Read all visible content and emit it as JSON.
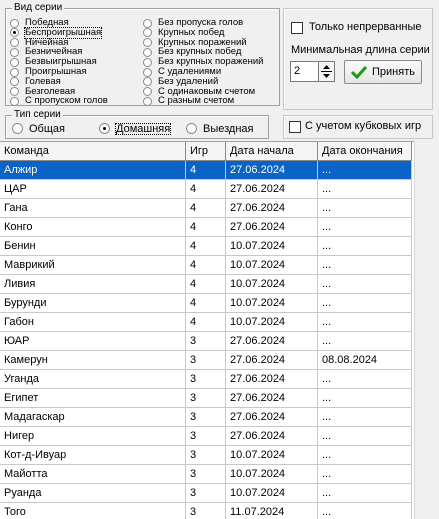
{
  "series_kind": {
    "legend": "Вид серии",
    "col1": [
      "Победная",
      "Беспроигрышная",
      "Ничейная",
      "Безничейная",
      "Безвыигрышная",
      "Проигрышная",
      "Голевая",
      "Безголевая",
      "С пропуском голов"
    ],
    "col2": [
      "Без пропуска голов",
      "Крупных побед",
      "Крупных поражений",
      "Без крупных побед",
      "Без крупных поражений",
      "С удалениями",
      "Без удалений",
      "С одинаковым счетом",
      "С разным счетом"
    ],
    "selected": "Беспроигрышная"
  },
  "options": {
    "only_continuous_label": "Только непрерванные",
    "only_continuous_checked": false,
    "min_length_label": "Минимальная длина серии",
    "min_length_value": "2",
    "apply_label": "Принять",
    "cup_games_label": "С учетом кубковых игр",
    "cup_games_checked": false
  },
  "series_type": {
    "legend": "Тип серии",
    "options": [
      "Общая",
      "Домашняя",
      "Выездная"
    ],
    "selected": "Домашняя"
  },
  "table": {
    "columns": [
      "Команда",
      "Игр",
      "Дата начала",
      "Дата окончания"
    ],
    "rows": [
      [
        "Алжир",
        "4",
        "27.06.2024",
        "..."
      ],
      [
        "ЦАР",
        "4",
        "27.06.2024",
        "..."
      ],
      [
        "Гана",
        "4",
        "27.06.2024",
        "..."
      ],
      [
        "Конго",
        "4",
        "27.06.2024",
        "..."
      ],
      [
        "Бенин",
        "4",
        "10.07.2024",
        "..."
      ],
      [
        "Маврикий",
        "4",
        "10.07.2024",
        "..."
      ],
      [
        "Ливия",
        "4",
        "10.07.2024",
        "..."
      ],
      [
        "Бурунди",
        "4",
        "10.07.2024",
        "..."
      ],
      [
        "Габон",
        "4",
        "10.07.2024",
        "..."
      ],
      [
        "ЮАР",
        "3",
        "27.06.2024",
        "..."
      ],
      [
        "Камерун",
        "3",
        "27.06.2024",
        "08.08.2024"
      ],
      [
        "Уганда",
        "3",
        "27.06.2024",
        "..."
      ],
      [
        "Египет",
        "3",
        "27.06.2024",
        "..."
      ],
      [
        "Мадагаскар",
        "3",
        "27.06.2024",
        "..."
      ],
      [
        "Нигер",
        "3",
        "27.06.2024",
        "..."
      ],
      [
        "Кот-д-Ивуар",
        "3",
        "10.07.2024",
        "..."
      ],
      [
        "Майотта",
        "3",
        "10.07.2024",
        "..."
      ],
      [
        "Руанда",
        "3",
        "10.07.2024",
        "..."
      ],
      [
        "Того",
        "3",
        "11.07.2024",
        "..."
      ]
    ],
    "selected_row": 0
  },
  "colors": {
    "selection": "#0a64c8",
    "apply_icon": "#1a9a1a"
  }
}
